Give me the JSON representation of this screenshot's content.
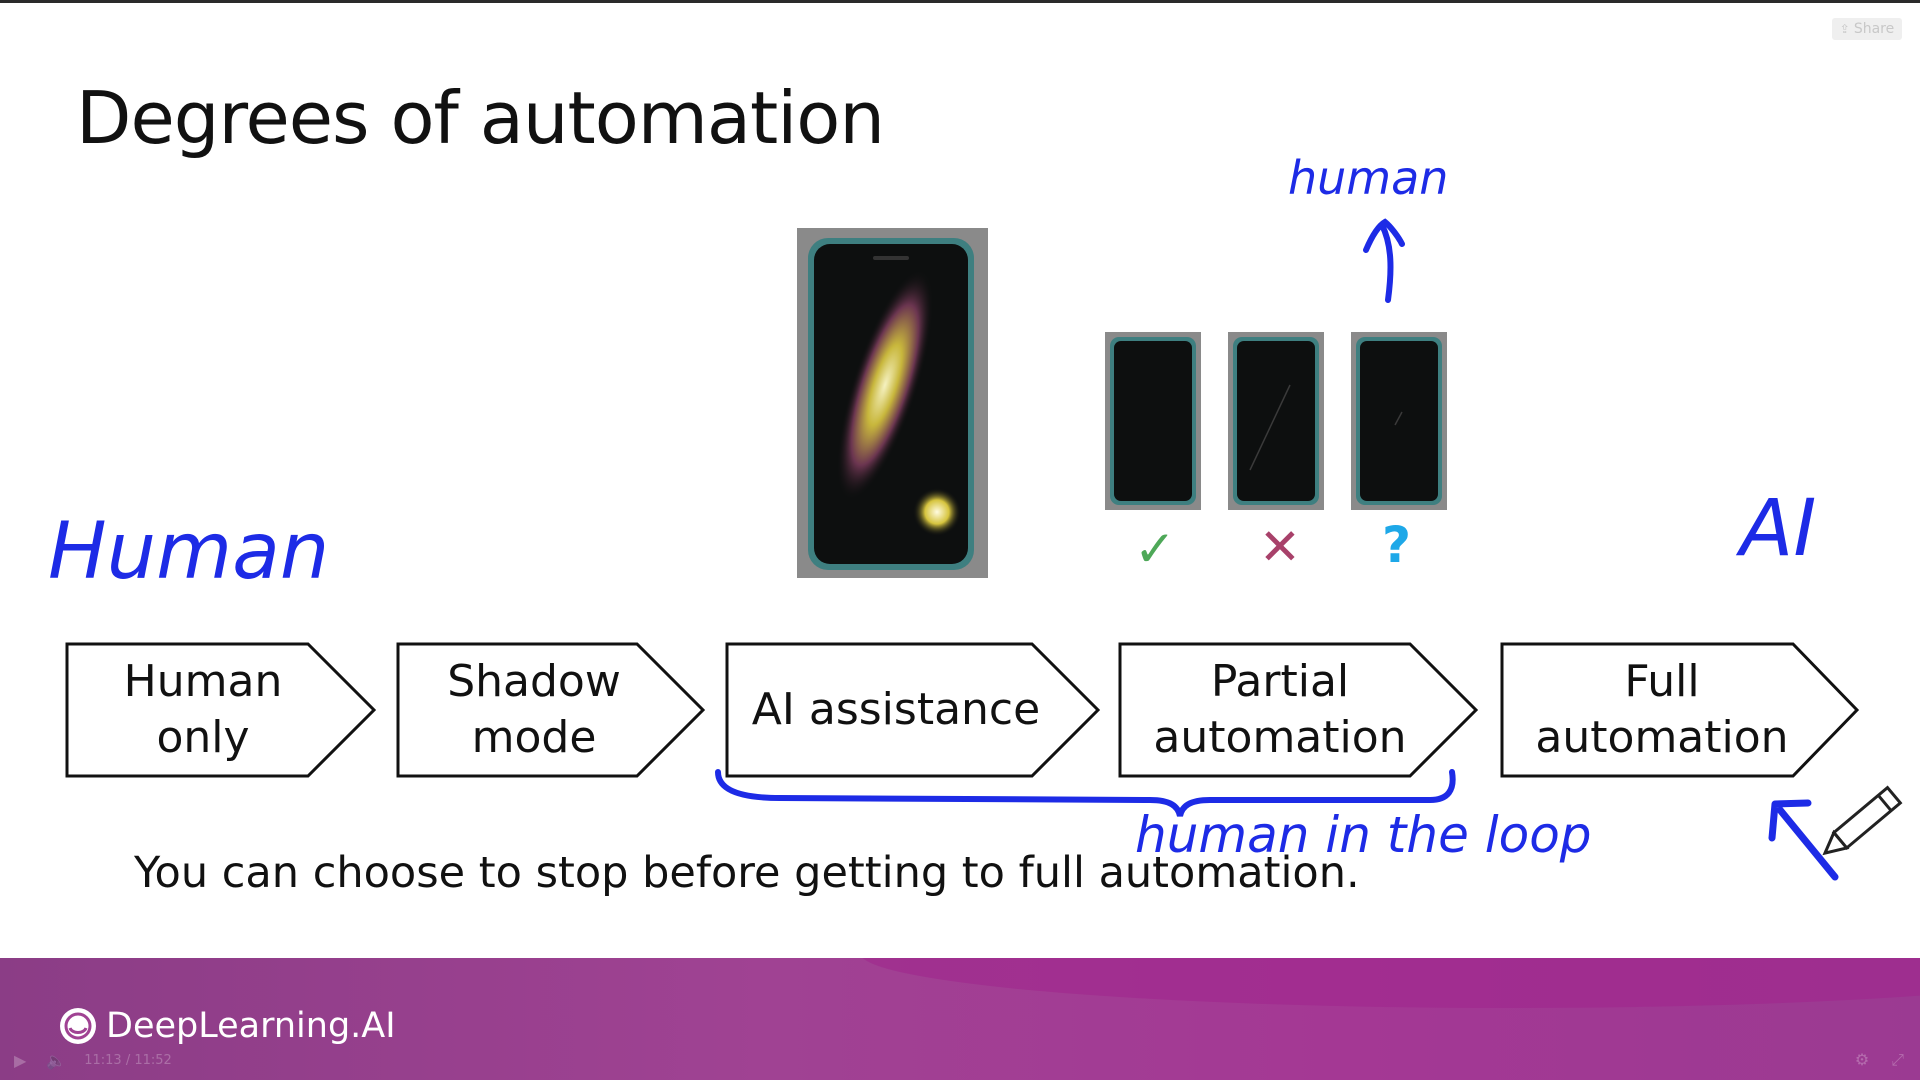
{
  "slide": {
    "title": "Degrees of automation",
    "stages": [
      {
        "line1": "Human",
        "line2": "only"
      },
      {
        "line1": "Shadow",
        "line2": "mode"
      },
      {
        "line1": "AI assistance",
        "line2": ""
      },
      {
        "line1": "Partial",
        "line2": "automation"
      },
      {
        "line1": "Full",
        "line2": "automation"
      }
    ],
    "caption": "You can choose to stop before getting to full automation.",
    "marks": {
      "check": "✓",
      "cross": "✕",
      "question": "?"
    },
    "annotations": {
      "human_left": "Human",
      "ai_right": "AI",
      "human_top": "human",
      "human_in_the_loop": "human in the loop"
    }
  },
  "overlay": {
    "share_label": "Share"
  },
  "footer": {
    "brand": "DeepLearning.AI"
  },
  "player": {
    "time": "11:13 / 11:52"
  },
  "colors": {
    "ink": "#1d2be6",
    "footer": "#9b3a92",
    "check": "#4ea858",
    "cross": "#a8416a",
    "question": "#1ea8e8"
  }
}
